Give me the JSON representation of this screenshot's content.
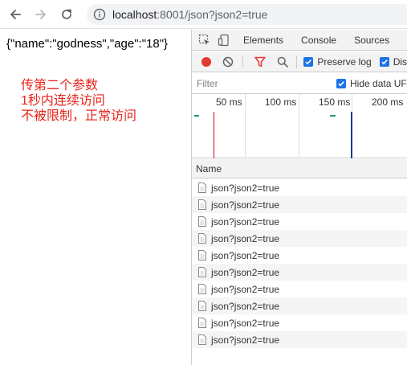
{
  "browser": {
    "url_host": "localhost",
    "url_path": ":8001/json?json2=true"
  },
  "page": {
    "json_text": "{\"name\":\"godness\",\"age\":\"18\"}",
    "note_lines": [
      "传第二个参数",
      "1秒内连续访问",
      "不被限制，正常访问"
    ]
  },
  "devtools": {
    "tabs": [
      "Elements",
      "Console",
      "Sources"
    ],
    "preserve_log_label": "Preserve log",
    "disable_cache_label": "Dis",
    "filter_placeholder": "Filter",
    "hide_data_urls_label": "Hide data UF",
    "timeline_ticks": [
      "50 ms",
      "100 ms",
      "150 ms",
      "200 ms"
    ],
    "name_column": "Name",
    "requests": [
      "json?json2=true",
      "json?json2=true",
      "json?json2=true",
      "json?json2=true",
      "json?json2=true",
      "json?json2=true",
      "json?json2=true",
      "json?json2=true",
      "json?json2=true",
      "json?json2=true"
    ]
  },
  "colors": {
    "note_red": "#e8231b",
    "record_red": "#e53935",
    "filter_red": "#e53935",
    "checkbox_blue": "#1a73e8"
  }
}
